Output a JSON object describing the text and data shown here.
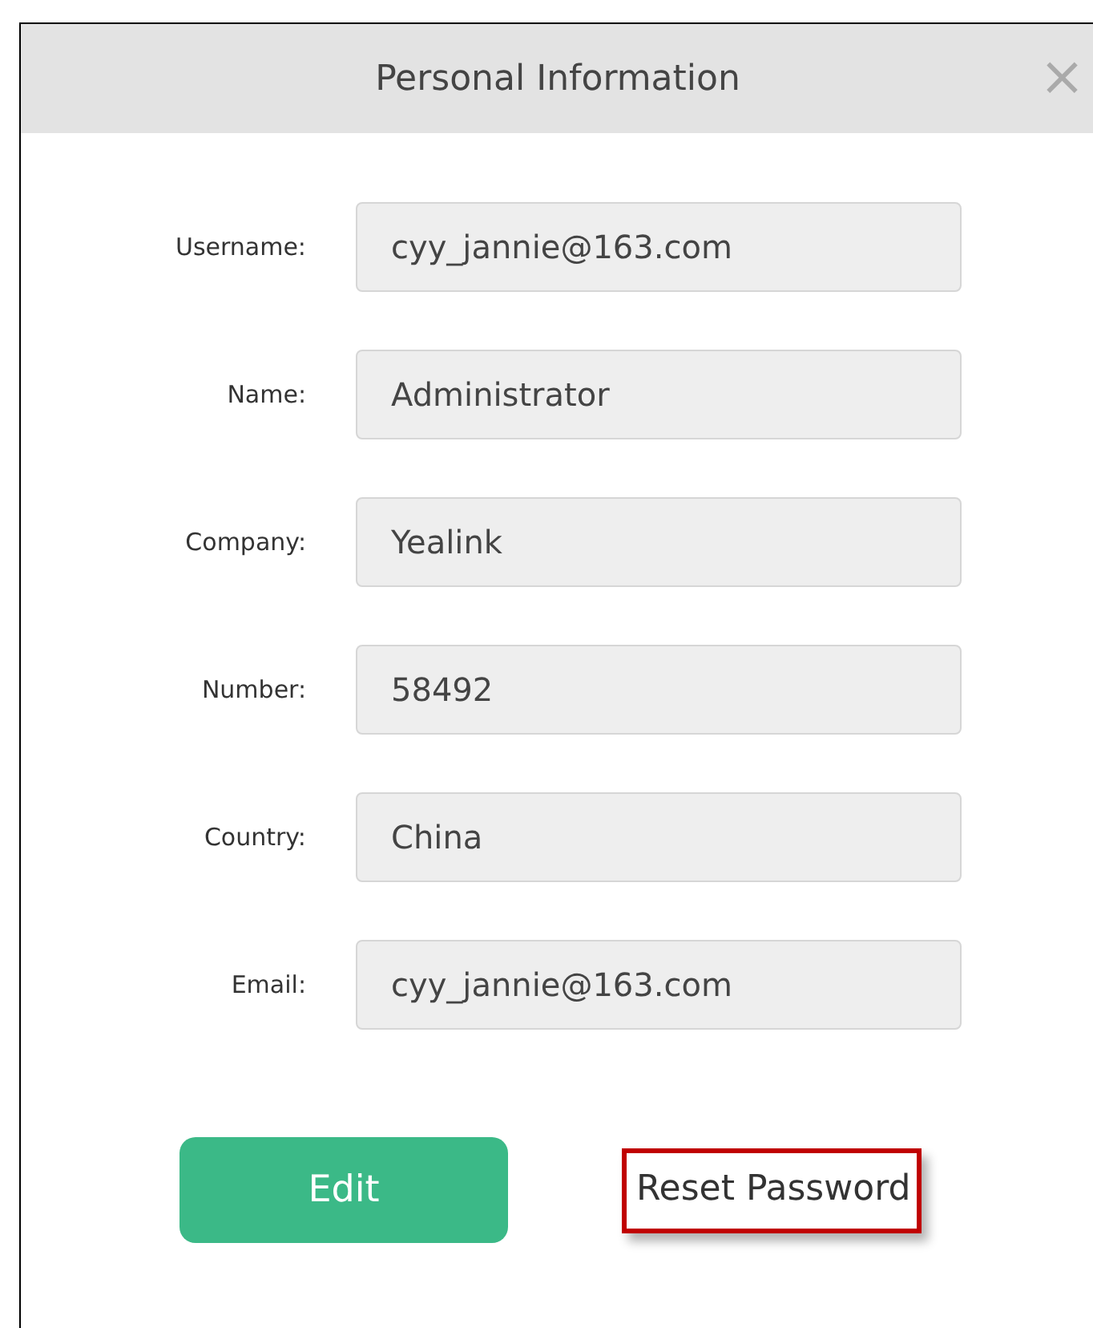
{
  "window": {
    "title": "Personal Information",
    "close": "×"
  },
  "fields": [
    {
      "label": "Username:",
      "value": "cyy_jannie@163.com"
    },
    {
      "label": "Name:",
      "value": "Administrator"
    },
    {
      "label": "Company:",
      "value": "Yealink"
    },
    {
      "label": "Number:",
      "value": "58492"
    },
    {
      "label": "Country:",
      "value": "China"
    },
    {
      "label": "Email:",
      "value": "cyy_jannie@163.com"
    }
  ],
  "edit_button": "Edit",
  "reset_link": {
    "label": "Reset Password",
    "highlighted": true
  }
}
